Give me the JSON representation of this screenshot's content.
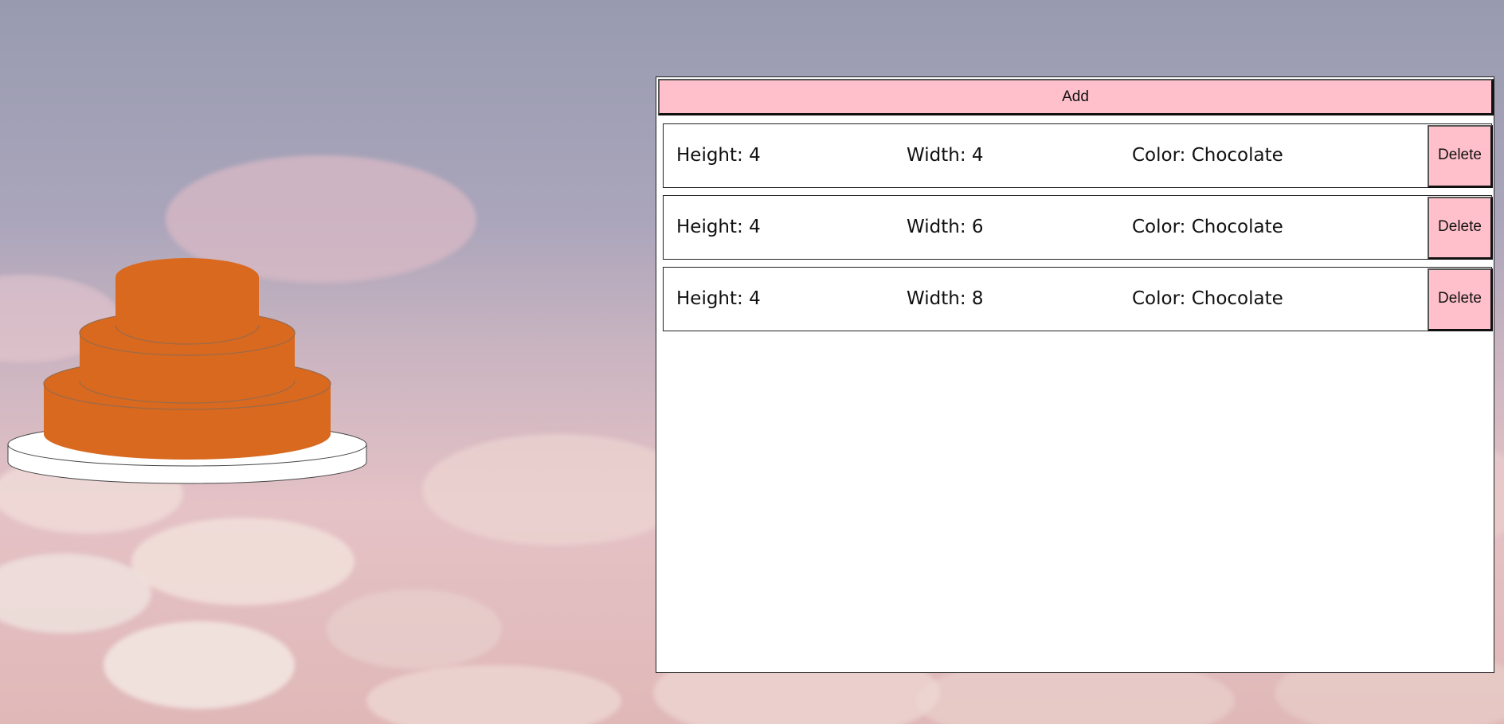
{
  "colors": {
    "button_bg": "#ffc0cb",
    "cake_tier": "#d8691f",
    "plate": "#ffffff"
  },
  "toolbar": {
    "add_label": "Add"
  },
  "tiers": [
    {
      "height": "Height: 4",
      "width": "Width: 4",
      "color": "Color: Chocolate",
      "delete_label": "Delete"
    },
    {
      "height": "Height: 4",
      "width": "Width: 6",
      "color": "Color: Chocolate",
      "delete_label": "Delete"
    },
    {
      "height": "Height: 4",
      "width": "Width: 8",
      "color": "Color: Chocolate",
      "delete_label": "Delete"
    }
  ]
}
